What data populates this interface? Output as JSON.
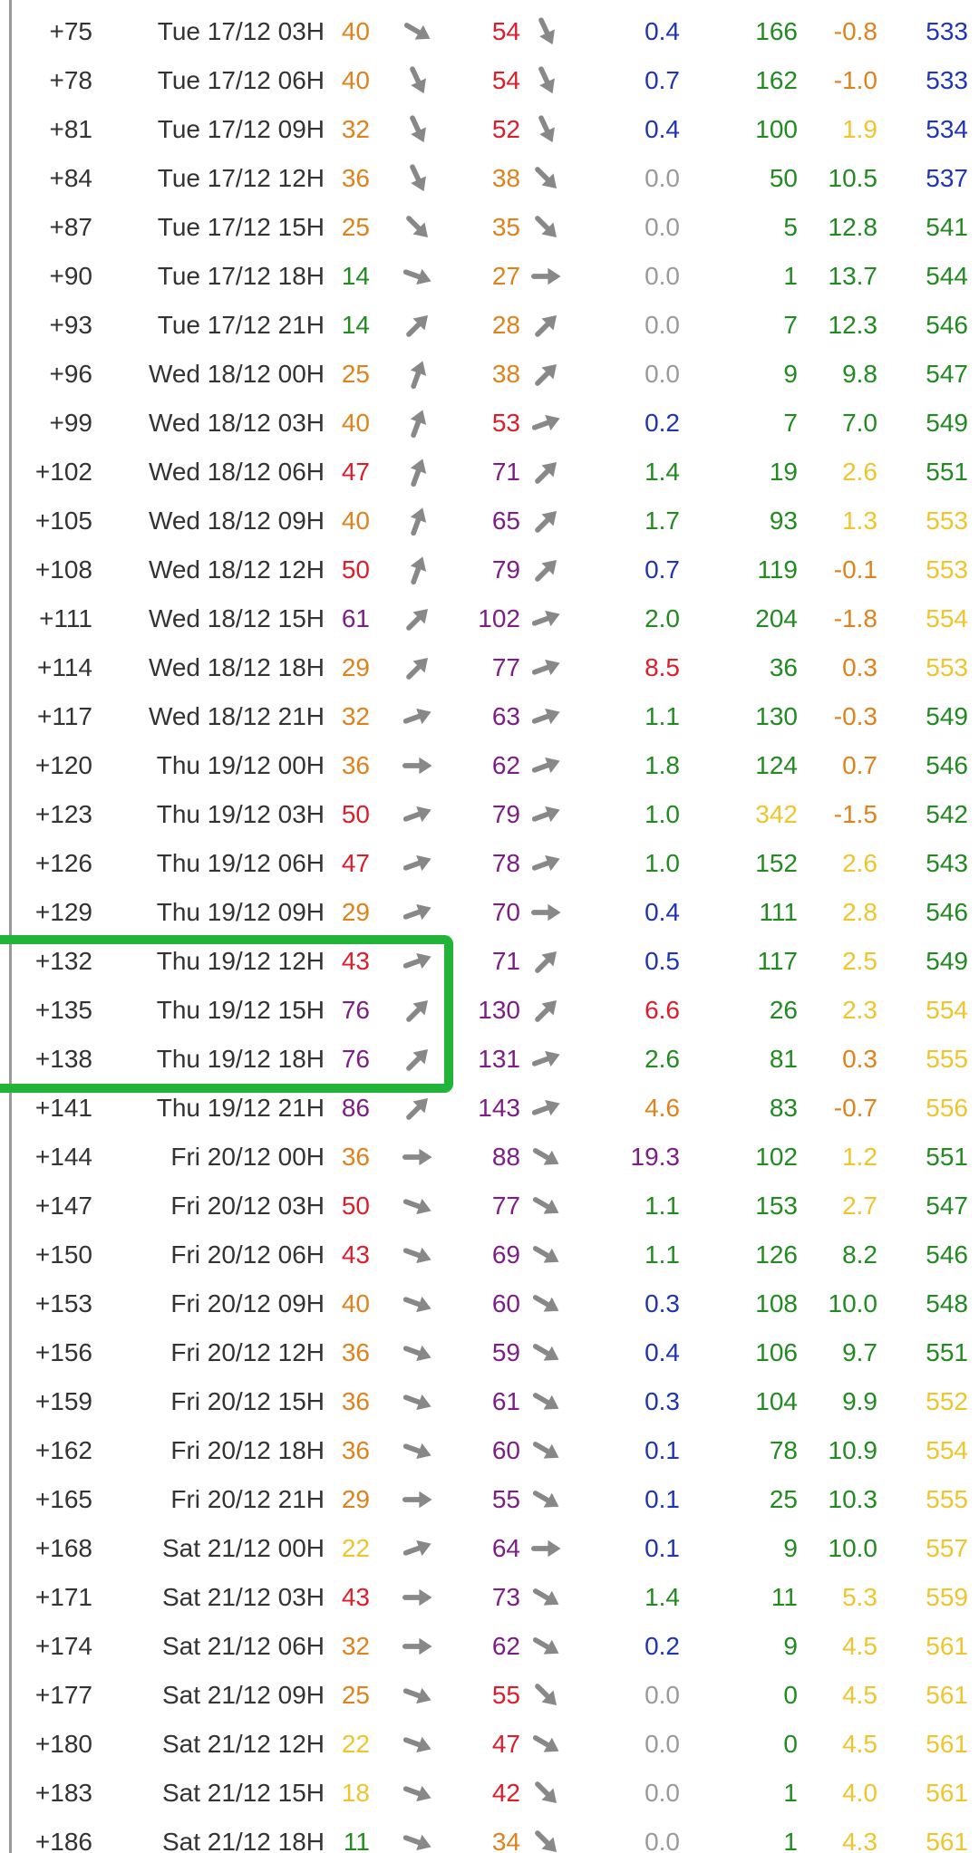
{
  "colors": {
    "blue": "#1f35b5",
    "green": "#218a21",
    "yellow": "#efc52e",
    "orange": "#e0821c",
    "red": "#dd1d2a",
    "purple": "#7d1e87",
    "gray": "#9a9a9a",
    "arrow": "#888888",
    "highlight": "#22b339"
  },
  "icons": {
    "direction": "wind-direction-arrow-icon"
  },
  "highlight": {
    "first_row": 19,
    "row_count": 3
  },
  "forecast_rows": [
    {
      "step": "+75",
      "date": "Tue 17/12 03H",
      "wind": "40",
      "wind_color": "orange",
      "wind_dir": 120,
      "gust": "54",
      "gust_color": "red",
      "gust_dir": 155,
      "prec": "0.4",
      "prec_color": "blue",
      "c6": "166",
      "c6_color": "green",
      "c7": "-0.8",
      "c7_color": "orange",
      "c8": "533",
      "c8_color": "blue"
    },
    {
      "step": "+78",
      "date": "Tue 17/12 06H",
      "wind": "40",
      "wind_color": "orange",
      "wind_dir": 155,
      "gust": "54",
      "gust_color": "red",
      "gust_dir": 155,
      "prec": "0.7",
      "prec_color": "blue",
      "c6": "162",
      "c6_color": "green",
      "c7": "-1.0",
      "c7_color": "orange",
      "c8": "533",
      "c8_color": "blue"
    },
    {
      "step": "+81",
      "date": "Tue 17/12 09H",
      "wind": "32",
      "wind_color": "orange",
      "wind_dir": 155,
      "gust": "52",
      "gust_color": "red",
      "gust_dir": 155,
      "prec": "0.4",
      "prec_color": "blue",
      "c6": "100",
      "c6_color": "green",
      "c7": "1.9",
      "c7_color": "yellow",
      "c8": "534",
      "c8_color": "blue"
    },
    {
      "step": "+84",
      "date": "Tue 17/12 12H",
      "wind": "36",
      "wind_color": "orange",
      "wind_dir": 155,
      "gust": "38",
      "gust_color": "orange",
      "gust_dir": 135,
      "prec": "0.0",
      "prec_color": "gray",
      "c6": "50",
      "c6_color": "green",
      "c7": "10.5",
      "c7_color": "green",
      "c8": "537",
      "c8_color": "blue"
    },
    {
      "step": "+87",
      "date": "Tue 17/12 15H",
      "wind": "25",
      "wind_color": "orange",
      "wind_dir": 135,
      "gust": "35",
      "gust_color": "orange",
      "gust_dir": 135,
      "prec": "0.0",
      "prec_color": "gray",
      "c6": "5",
      "c6_color": "green",
      "c7": "12.8",
      "c7_color": "green",
      "c8": "541",
      "c8_color": "green"
    },
    {
      "step": "+90",
      "date": "Tue 17/12 18H",
      "wind": "14",
      "wind_color": "green",
      "wind_dir": 110,
      "gust": "27",
      "gust_color": "orange",
      "gust_dir": 90,
      "prec": "0.0",
      "prec_color": "gray",
      "c6": "1",
      "c6_color": "green",
      "c7": "13.7",
      "c7_color": "green",
      "c8": "544",
      "c8_color": "green"
    },
    {
      "step": "+93",
      "date": "Tue 17/12 21H",
      "wind": "14",
      "wind_color": "green",
      "wind_dir": 45,
      "gust": "28",
      "gust_color": "orange",
      "gust_dir": 45,
      "prec": "0.0",
      "prec_color": "gray",
      "c6": "7",
      "c6_color": "green",
      "c7": "12.3",
      "c7_color": "green",
      "c8": "546",
      "c8_color": "green"
    },
    {
      "step": "+96",
      "date": "Wed 18/12 00H",
      "wind": "25",
      "wind_color": "orange",
      "wind_dir": 20,
      "gust": "38",
      "gust_color": "orange",
      "gust_dir": 45,
      "prec": "0.0",
      "prec_color": "gray",
      "c6": "9",
      "c6_color": "green",
      "c7": "9.8",
      "c7_color": "green",
      "c8": "547",
      "c8_color": "green"
    },
    {
      "step": "+99",
      "date": "Wed 18/12 03H",
      "wind": "40",
      "wind_color": "orange",
      "wind_dir": 20,
      "gust": "53",
      "gust_color": "red",
      "gust_dir": 70,
      "prec": "0.2",
      "prec_color": "blue",
      "c6": "7",
      "c6_color": "green",
      "c7": "7.0",
      "c7_color": "green",
      "c8": "549",
      "c8_color": "green"
    },
    {
      "step": "+102",
      "date": "Wed 18/12 06H",
      "wind": "47",
      "wind_color": "red",
      "wind_dir": 20,
      "gust": "71",
      "gust_color": "purple",
      "gust_dir": 45,
      "prec": "1.4",
      "prec_color": "green",
      "c6": "19",
      "c6_color": "green",
      "c7": "2.6",
      "c7_color": "yellow",
      "c8": "551",
      "c8_color": "green"
    },
    {
      "step": "+105",
      "date": "Wed 18/12 09H",
      "wind": "40",
      "wind_color": "orange",
      "wind_dir": 20,
      "gust": "65",
      "gust_color": "purple",
      "gust_dir": 45,
      "prec": "1.7",
      "prec_color": "green",
      "c6": "93",
      "c6_color": "green",
      "c7": "1.3",
      "c7_color": "yellow",
      "c8": "553",
      "c8_color": "yellow"
    },
    {
      "step": "+108",
      "date": "Wed 18/12 12H",
      "wind": "50",
      "wind_color": "red",
      "wind_dir": 20,
      "gust": "79",
      "gust_color": "purple",
      "gust_dir": 45,
      "prec": "0.7",
      "prec_color": "blue",
      "c6": "119",
      "c6_color": "green",
      "c7": "-0.1",
      "c7_color": "orange",
      "c8": "553",
      "c8_color": "yellow"
    },
    {
      "step": "+111",
      "date": "Wed 18/12 15H",
      "wind": "61",
      "wind_color": "purple",
      "wind_dir": 45,
      "gust": "102",
      "gust_color": "purple",
      "gust_dir": 70,
      "prec": "2.0",
      "prec_color": "green",
      "c6": "204",
      "c6_color": "green",
      "c7": "-1.8",
      "c7_color": "orange",
      "c8": "554",
      "c8_color": "yellow"
    },
    {
      "step": "+114",
      "date": "Wed 18/12 18H",
      "wind": "29",
      "wind_color": "orange",
      "wind_dir": 45,
      "gust": "77",
      "gust_color": "purple",
      "gust_dir": 70,
      "prec": "8.5",
      "prec_color": "red",
      "c6": "36",
      "c6_color": "green",
      "c7": "0.3",
      "c7_color": "orange",
      "c8": "553",
      "c8_color": "yellow"
    },
    {
      "step": "+117",
      "date": "Wed 18/12 21H",
      "wind": "32",
      "wind_color": "orange",
      "wind_dir": 70,
      "gust": "63",
      "gust_color": "purple",
      "gust_dir": 70,
      "prec": "1.1",
      "prec_color": "green",
      "c6": "130",
      "c6_color": "green",
      "c7": "-0.3",
      "c7_color": "orange",
      "c8": "549",
      "c8_color": "green"
    },
    {
      "step": "+120",
      "date": "Thu 19/12 00H",
      "wind": "36",
      "wind_color": "orange",
      "wind_dir": 90,
      "gust": "62",
      "gust_color": "purple",
      "gust_dir": 70,
      "prec": "1.8",
      "prec_color": "green",
      "c6": "124",
      "c6_color": "green",
      "c7": "0.7",
      "c7_color": "orange",
      "c8": "546",
      "c8_color": "green"
    },
    {
      "step": "+123",
      "date": "Thu 19/12 03H",
      "wind": "50",
      "wind_color": "red",
      "wind_dir": 70,
      "gust": "79",
      "gust_color": "purple",
      "gust_dir": 70,
      "prec": "1.0",
      "prec_color": "green",
      "c6": "342",
      "c6_color": "yellow",
      "c7": "-1.5",
      "c7_color": "orange",
      "c8": "542",
      "c8_color": "green"
    },
    {
      "step": "+126",
      "date": "Thu 19/12 06H",
      "wind": "47",
      "wind_color": "red",
      "wind_dir": 70,
      "gust": "78",
      "gust_color": "purple",
      "gust_dir": 70,
      "prec": "1.0",
      "prec_color": "green",
      "c6": "152",
      "c6_color": "green",
      "c7": "2.6",
      "c7_color": "yellow",
      "c8": "543",
      "c8_color": "green"
    },
    {
      "step": "+129",
      "date": "Thu 19/12 09H",
      "wind": "29",
      "wind_color": "orange",
      "wind_dir": 70,
      "gust": "70",
      "gust_color": "purple",
      "gust_dir": 90,
      "prec": "0.4",
      "prec_color": "blue",
      "c6": "111",
      "c6_color": "green",
      "c7": "2.8",
      "c7_color": "yellow",
      "c8": "546",
      "c8_color": "green"
    },
    {
      "step": "+132",
      "date": "Thu 19/12 12H",
      "wind": "43",
      "wind_color": "red",
      "wind_dir": 70,
      "gust": "71",
      "gust_color": "purple",
      "gust_dir": 45,
      "prec": "0.5",
      "prec_color": "blue",
      "c6": "117",
      "c6_color": "green",
      "c7": "2.5",
      "c7_color": "yellow",
      "c8": "549",
      "c8_color": "green"
    },
    {
      "step": "+135",
      "date": "Thu 19/12 15H",
      "wind": "76",
      "wind_color": "purple",
      "wind_dir": 45,
      "gust": "130",
      "gust_color": "purple",
      "gust_dir": 45,
      "prec": "6.6",
      "prec_color": "red",
      "c6": "26",
      "c6_color": "green",
      "c7": "2.3",
      "c7_color": "yellow",
      "c8": "554",
      "c8_color": "yellow"
    },
    {
      "step": "+138",
      "date": "Thu 19/12 18H",
      "wind": "76",
      "wind_color": "purple",
      "wind_dir": 45,
      "gust": "131",
      "gust_color": "purple",
      "gust_dir": 70,
      "prec": "2.6",
      "prec_color": "green",
      "c6": "81",
      "c6_color": "green",
      "c7": "0.3",
      "c7_color": "orange",
      "c8": "555",
      "c8_color": "yellow"
    },
    {
      "step": "+141",
      "date": "Thu 19/12 21H",
      "wind": "86",
      "wind_color": "purple",
      "wind_dir": 45,
      "gust": "143",
      "gust_color": "purple",
      "gust_dir": 70,
      "prec": "4.6",
      "prec_color": "orange",
      "c6": "83",
      "c6_color": "green",
      "c7": "-0.7",
      "c7_color": "orange",
      "c8": "556",
      "c8_color": "yellow"
    },
    {
      "step": "+144",
      "date": "Fri 20/12 00H",
      "wind": "36",
      "wind_color": "orange",
      "wind_dir": 90,
      "gust": "88",
      "gust_color": "purple",
      "gust_dir": 120,
      "prec": "19.3",
      "prec_color": "purple",
      "c6": "102",
      "c6_color": "green",
      "c7": "1.2",
      "c7_color": "yellow",
      "c8": "551",
      "c8_color": "green"
    },
    {
      "step": "+147",
      "date": "Fri 20/12 03H",
      "wind": "50",
      "wind_color": "red",
      "wind_dir": 110,
      "gust": "77",
      "gust_color": "purple",
      "gust_dir": 120,
      "prec": "1.1",
      "prec_color": "green",
      "c6": "153",
      "c6_color": "green",
      "c7": "2.7",
      "c7_color": "yellow",
      "c8": "547",
      "c8_color": "green"
    },
    {
      "step": "+150",
      "date": "Fri 20/12 06H",
      "wind": "43",
      "wind_color": "red",
      "wind_dir": 110,
      "gust": "69",
      "gust_color": "purple",
      "gust_dir": 120,
      "prec": "1.1",
      "prec_color": "green",
      "c6": "126",
      "c6_color": "green",
      "c7": "8.2",
      "c7_color": "green",
      "c8": "546",
      "c8_color": "green"
    },
    {
      "step": "+153",
      "date": "Fri 20/12 09H",
      "wind": "40",
      "wind_color": "orange",
      "wind_dir": 110,
      "gust": "60",
      "gust_color": "purple",
      "gust_dir": 120,
      "prec": "0.3",
      "prec_color": "blue",
      "c6": "108",
      "c6_color": "green",
      "c7": "10.0",
      "c7_color": "green",
      "c8": "548",
      "c8_color": "green"
    },
    {
      "step": "+156",
      "date": "Fri 20/12 12H",
      "wind": "36",
      "wind_color": "orange",
      "wind_dir": 110,
      "gust": "59",
      "gust_color": "purple",
      "gust_dir": 120,
      "prec": "0.4",
      "prec_color": "blue",
      "c6": "106",
      "c6_color": "green",
      "c7": "9.7",
      "c7_color": "green",
      "c8": "551",
      "c8_color": "green"
    },
    {
      "step": "+159",
      "date": "Fri 20/12 15H",
      "wind": "36",
      "wind_color": "orange",
      "wind_dir": 110,
      "gust": "61",
      "gust_color": "purple",
      "gust_dir": 120,
      "prec": "0.3",
      "prec_color": "blue",
      "c6": "104",
      "c6_color": "green",
      "c7": "9.9",
      "c7_color": "green",
      "c8": "552",
      "c8_color": "yellow"
    },
    {
      "step": "+162",
      "date": "Fri 20/12 18H",
      "wind": "36",
      "wind_color": "orange",
      "wind_dir": 110,
      "gust": "60",
      "gust_color": "purple",
      "gust_dir": 120,
      "prec": "0.1",
      "prec_color": "blue",
      "c6": "78",
      "c6_color": "green",
      "c7": "10.9",
      "c7_color": "green",
      "c8": "554",
      "c8_color": "yellow"
    },
    {
      "step": "+165",
      "date": "Fri 20/12 21H",
      "wind": "29",
      "wind_color": "orange",
      "wind_dir": 90,
      "gust": "55",
      "gust_color": "purple",
      "gust_dir": 120,
      "prec": "0.1",
      "prec_color": "blue",
      "c6": "25",
      "c6_color": "green",
      "c7": "10.3",
      "c7_color": "green",
      "c8": "555",
      "c8_color": "yellow"
    },
    {
      "step": "+168",
      "date": "Sat 21/12 00H",
      "wind": "22",
      "wind_color": "yellow",
      "wind_dir": 70,
      "gust": "64",
      "gust_color": "purple",
      "gust_dir": 90,
      "prec": "0.1",
      "prec_color": "blue",
      "c6": "9",
      "c6_color": "green",
      "c7": "10.0",
      "c7_color": "green",
      "c8": "557",
      "c8_color": "yellow"
    },
    {
      "step": "+171",
      "date": "Sat 21/12 03H",
      "wind": "43",
      "wind_color": "red",
      "wind_dir": 90,
      "gust": "73",
      "gust_color": "purple",
      "gust_dir": 120,
      "prec": "1.4",
      "prec_color": "green",
      "c6": "11",
      "c6_color": "green",
      "c7": "5.3",
      "c7_color": "yellow",
      "c8": "559",
      "c8_color": "yellow"
    },
    {
      "step": "+174",
      "date": "Sat 21/12 06H",
      "wind": "32",
      "wind_color": "orange",
      "wind_dir": 90,
      "gust": "62",
      "gust_color": "purple",
      "gust_dir": 120,
      "prec": "0.2",
      "prec_color": "blue",
      "c6": "9",
      "c6_color": "green",
      "c7": "4.5",
      "c7_color": "yellow",
      "c8": "561",
      "c8_color": "yellow"
    },
    {
      "step": "+177",
      "date": "Sat 21/12 09H",
      "wind": "25",
      "wind_color": "orange",
      "wind_dir": 110,
      "gust": "55",
      "gust_color": "red",
      "gust_dir": 135,
      "prec": "0.0",
      "prec_color": "gray",
      "c6": "0",
      "c6_color": "green",
      "c7": "4.5",
      "c7_color": "yellow",
      "c8": "561",
      "c8_color": "yellow"
    },
    {
      "step": "+180",
      "date": "Sat 21/12 12H",
      "wind": "22",
      "wind_color": "yellow",
      "wind_dir": 110,
      "gust": "47",
      "gust_color": "red",
      "gust_dir": 120,
      "prec": "0.0",
      "prec_color": "gray",
      "c6": "0",
      "c6_color": "green",
      "c7": "4.5",
      "c7_color": "yellow",
      "c8": "561",
      "c8_color": "yellow"
    },
    {
      "step": "+183",
      "date": "Sat 21/12 15H",
      "wind": "18",
      "wind_color": "yellow",
      "wind_dir": 110,
      "gust": "42",
      "gust_color": "red",
      "gust_dir": 135,
      "prec": "0.0",
      "prec_color": "gray",
      "c6": "1",
      "c6_color": "green",
      "c7": "4.0",
      "c7_color": "yellow",
      "c8": "561",
      "c8_color": "yellow"
    },
    {
      "step": "+186",
      "date": "Sat 21/12 18H",
      "wind": "11",
      "wind_color": "green",
      "wind_dir": 110,
      "gust": "34",
      "gust_color": "orange",
      "gust_dir": 135,
      "prec": "0.0",
      "prec_color": "gray",
      "c6": "1",
      "c6_color": "green",
      "c7": "4.3",
      "c7_color": "yellow",
      "c8": "561",
      "c8_color": "yellow"
    }
  ]
}
